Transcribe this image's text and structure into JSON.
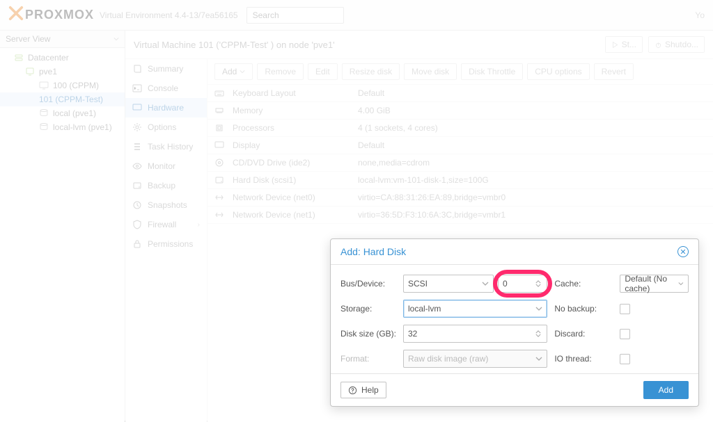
{
  "brand": {
    "text": "PROXMOX",
    "version": "Virtual Environment 4.4-13/7ea56165"
  },
  "search": {
    "ph": "Search"
  },
  "header_right": "Yo",
  "left": {
    "head": "Server View",
    "tree": {
      "dc": "Datacenter",
      "node": "pve1",
      "vm100": "100 (CPPM)",
      "vm101": "101 (CPPM-Test)",
      "local": "local (pve1)",
      "locallvm": "local-lvm (pve1)"
    }
  },
  "content": {
    "title": "Virtual Machine 101 ('CPPM-Test' ) on node 'pve1'",
    "btn_start": "St...",
    "btn_shut": "Shutdo..."
  },
  "sidebar": {
    "summary": "Summary",
    "console": "Console",
    "hardware": "Hardware",
    "options": "Options",
    "task": "Task History",
    "monitor": "Monitor",
    "backup": "Backup",
    "snapshots": "Snapshots",
    "firewall": "Firewall",
    "perm": "Permissions"
  },
  "toolbar": {
    "add": "Add",
    "remove": "Remove",
    "edit": "Edit",
    "resize": "Resize disk",
    "move": "Move disk",
    "throttle": "Disk Throttle",
    "cpu": "CPU options",
    "revert": "Revert"
  },
  "hw": {
    "keyboard_n": "Keyboard Layout",
    "keyboard_v": "Default",
    "memory_n": "Memory",
    "memory_v": "4.00 GiB",
    "proc_n": "Processors",
    "proc_v": "4 (1 sockets, 4 cores)",
    "display_n": "Display",
    "display_v": "Default",
    "cd_n": "CD/DVD Drive (ide2)",
    "cd_v": "none,media=cdrom",
    "hdd_n": "Hard Disk (scsi1)",
    "hdd_v": "local-lvm:vm-101-disk-1,size=100G",
    "net0_n": "Network Device (net0)",
    "net0_v": "virtio=CA:88:31:26:EA:89,bridge=vmbr0",
    "net1_n": "Network Device (net1)",
    "net1_v": "virtio=36:5D:F3:10:6A:3C,bridge=vmbr1"
  },
  "dialog": {
    "title": "Add: Hard Disk",
    "bus_label": "Bus/Device:",
    "bus_val": "SCSI",
    "bus_num": "0",
    "storage_label": "Storage:",
    "storage_val": "local-lvm",
    "size_label": "Disk size (GB):",
    "size_val": "32",
    "format_label": "Format:",
    "format_val": "Raw disk image (raw)",
    "cache_label": "Cache:",
    "cache_val": "Default (No cache)",
    "nobackup_label": "No backup:",
    "discard_label": "Discard:",
    "iothread_label": "IO thread:",
    "help": "Help",
    "add": "Add"
  }
}
